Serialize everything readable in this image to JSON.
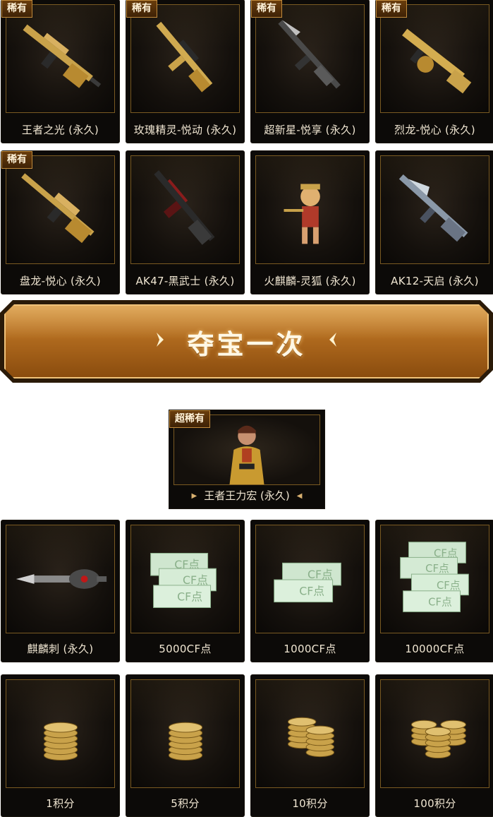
{
  "badges": {
    "rare": "稀有",
    "super_rare": "超稀有"
  },
  "row1": [
    {
      "name": "王者之光 (永久)",
      "rare": true,
      "icon": "gold-sniper-rifle-icon"
    },
    {
      "name": "玫瑰精灵-悦动 (永久)",
      "rare": true,
      "icon": "gold-assault-rifle-icon"
    },
    {
      "name": "超新星-悦享 (永久)",
      "rare": true,
      "icon": "dark-blade-rifle-icon"
    },
    {
      "name": "烈龙-悦心 (永久)",
      "rare": true,
      "icon": "gold-tommy-gun-icon"
    }
  ],
  "row2": [
    {
      "name": "盘龙-悦心 (永久)",
      "rare": true,
      "icon": "gold-machine-gun-icon"
    },
    {
      "name": "AK47-黑武士 (永久)",
      "rare": false,
      "icon": "black-ak47-icon"
    },
    {
      "name": "火麒麟-灵狐 (永久)",
      "rare": false,
      "icon": "fox-character-icon"
    },
    {
      "name": "AK12-天启 (永久)",
      "rare": false,
      "icon": "silver-ak12-icon"
    }
  ],
  "draw_button": {
    "label": "夺宝一次"
  },
  "super_item": {
    "name": "王者王力宏 (永久)",
    "icon": "character-portrait-icon"
  },
  "row3": [
    {
      "name": "麒麟刺 (永久)",
      "icon": "qilin-knife-icon"
    },
    {
      "name": "5000CF点",
      "icon": "cf-points-stack-icon",
      "notes": 3
    },
    {
      "name": "1000CF点",
      "icon": "cf-points-stack-icon",
      "notes": 2
    },
    {
      "name": "10000CF点",
      "icon": "cf-points-stack-icon",
      "notes": 4
    }
  ],
  "row4": [
    {
      "name": "1积分",
      "icon": "coin-stack-icon",
      "stacks": 1
    },
    {
      "name": "5积分",
      "icon": "coin-stack-icon",
      "stacks": 1
    },
    {
      "name": "10积分",
      "icon": "coin-stack-icon",
      "stacks": 2
    },
    {
      "name": "100积分",
      "icon": "coin-stack-icon",
      "stacks": 3
    }
  ],
  "note_text": "CF点",
  "colors": {
    "gold": "#c9a24a",
    "frame": "#7a5a22",
    "banner": "#b06a1e",
    "note": "#cfe6cf"
  }
}
